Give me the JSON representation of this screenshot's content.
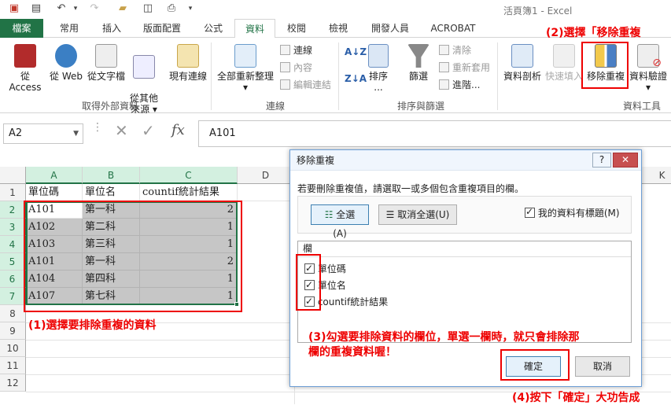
{
  "title_bar": {
    "doc_title": "活頁簿1 - Excel"
  },
  "tabs": [
    {
      "label": "檔案"
    },
    {
      "label": "常用"
    },
    {
      "label": "插入"
    },
    {
      "label": "版面配置"
    },
    {
      "label": "公式"
    },
    {
      "label": "資料"
    },
    {
      "label": "校閱"
    },
    {
      "label": "檢視"
    },
    {
      "label": "開發人員"
    },
    {
      "label": "ACROBAT"
    }
  ],
  "ribbon": {
    "ext_data": {
      "buttons": [
        "從 Access",
        "從 Web",
        "從文字檔",
        "從其他\n來源 ▾",
        "現有連線"
      ],
      "label": "取得外部資料"
    },
    "connections": {
      "refresh_all": "全部重新整理",
      "refresh_all_arrow": "▾",
      "items": [
        "連線",
        "內容",
        "編輯連結"
      ],
      "label": "連線"
    },
    "sort_filter": {
      "sort": "排序",
      "sort_more": "...",
      "filter": "篩選",
      "items": [
        "清除",
        "重新套用",
        "進階..."
      ],
      "label": "排序與篩選"
    },
    "data_tools": {
      "text_to_columns": "資料剖析",
      "flash_fill": "快速填入",
      "remove_duplicates": "移除重複",
      "validation": "資料驗證",
      "validation_arrow": "▾",
      "label": "資料工具"
    }
  },
  "formula_bar": {
    "name_box": "A2",
    "content": "A101",
    "fx": "fx"
  },
  "sheet": {
    "columns": [
      "A",
      "B",
      "C",
      "D",
      "K"
    ],
    "rows": [
      "1",
      "2",
      "3",
      "4",
      "5",
      "6",
      "7",
      "8",
      "9",
      "10",
      "11",
      "12"
    ],
    "header_row": [
      "單位碼",
      "單位名",
      "countif統計結果"
    ],
    "data": [
      [
        "A101",
        "第一科",
        "2"
      ],
      [
        "A102",
        "第二科",
        "1"
      ],
      [
        "A103",
        "第三科",
        "1"
      ],
      [
        "A101",
        "第一科",
        "2"
      ],
      [
        "A104",
        "第四科",
        "1"
      ],
      [
        "A107",
        "第七科",
        "1"
      ]
    ]
  },
  "dialog": {
    "title": "移除重複",
    "help": "?",
    "close": "✕",
    "instruction": "若要刪除重複值，請選取一或多個包含重複項目的欄。",
    "select_all": "全選(A)",
    "unselect_all": "取消全選(U)",
    "has_headers": "我的資料有標題(M)",
    "column_header": "欄",
    "columns": [
      "單位碼",
      "單位名",
      "countif統計結果"
    ],
    "ok": "確定",
    "cancel": "取消"
  },
  "annotations": {
    "step1": "(1)選擇要排除重複的資料",
    "step2": "(2)選擇「移除重複",
    "step3_line1": "(3)勾選要排除資料的欄位，單選一欄時，就只會排除那",
    "step3_line2": "欄的重複資料喔！",
    "step4": "(4)按下「確定」大功告成"
  }
}
